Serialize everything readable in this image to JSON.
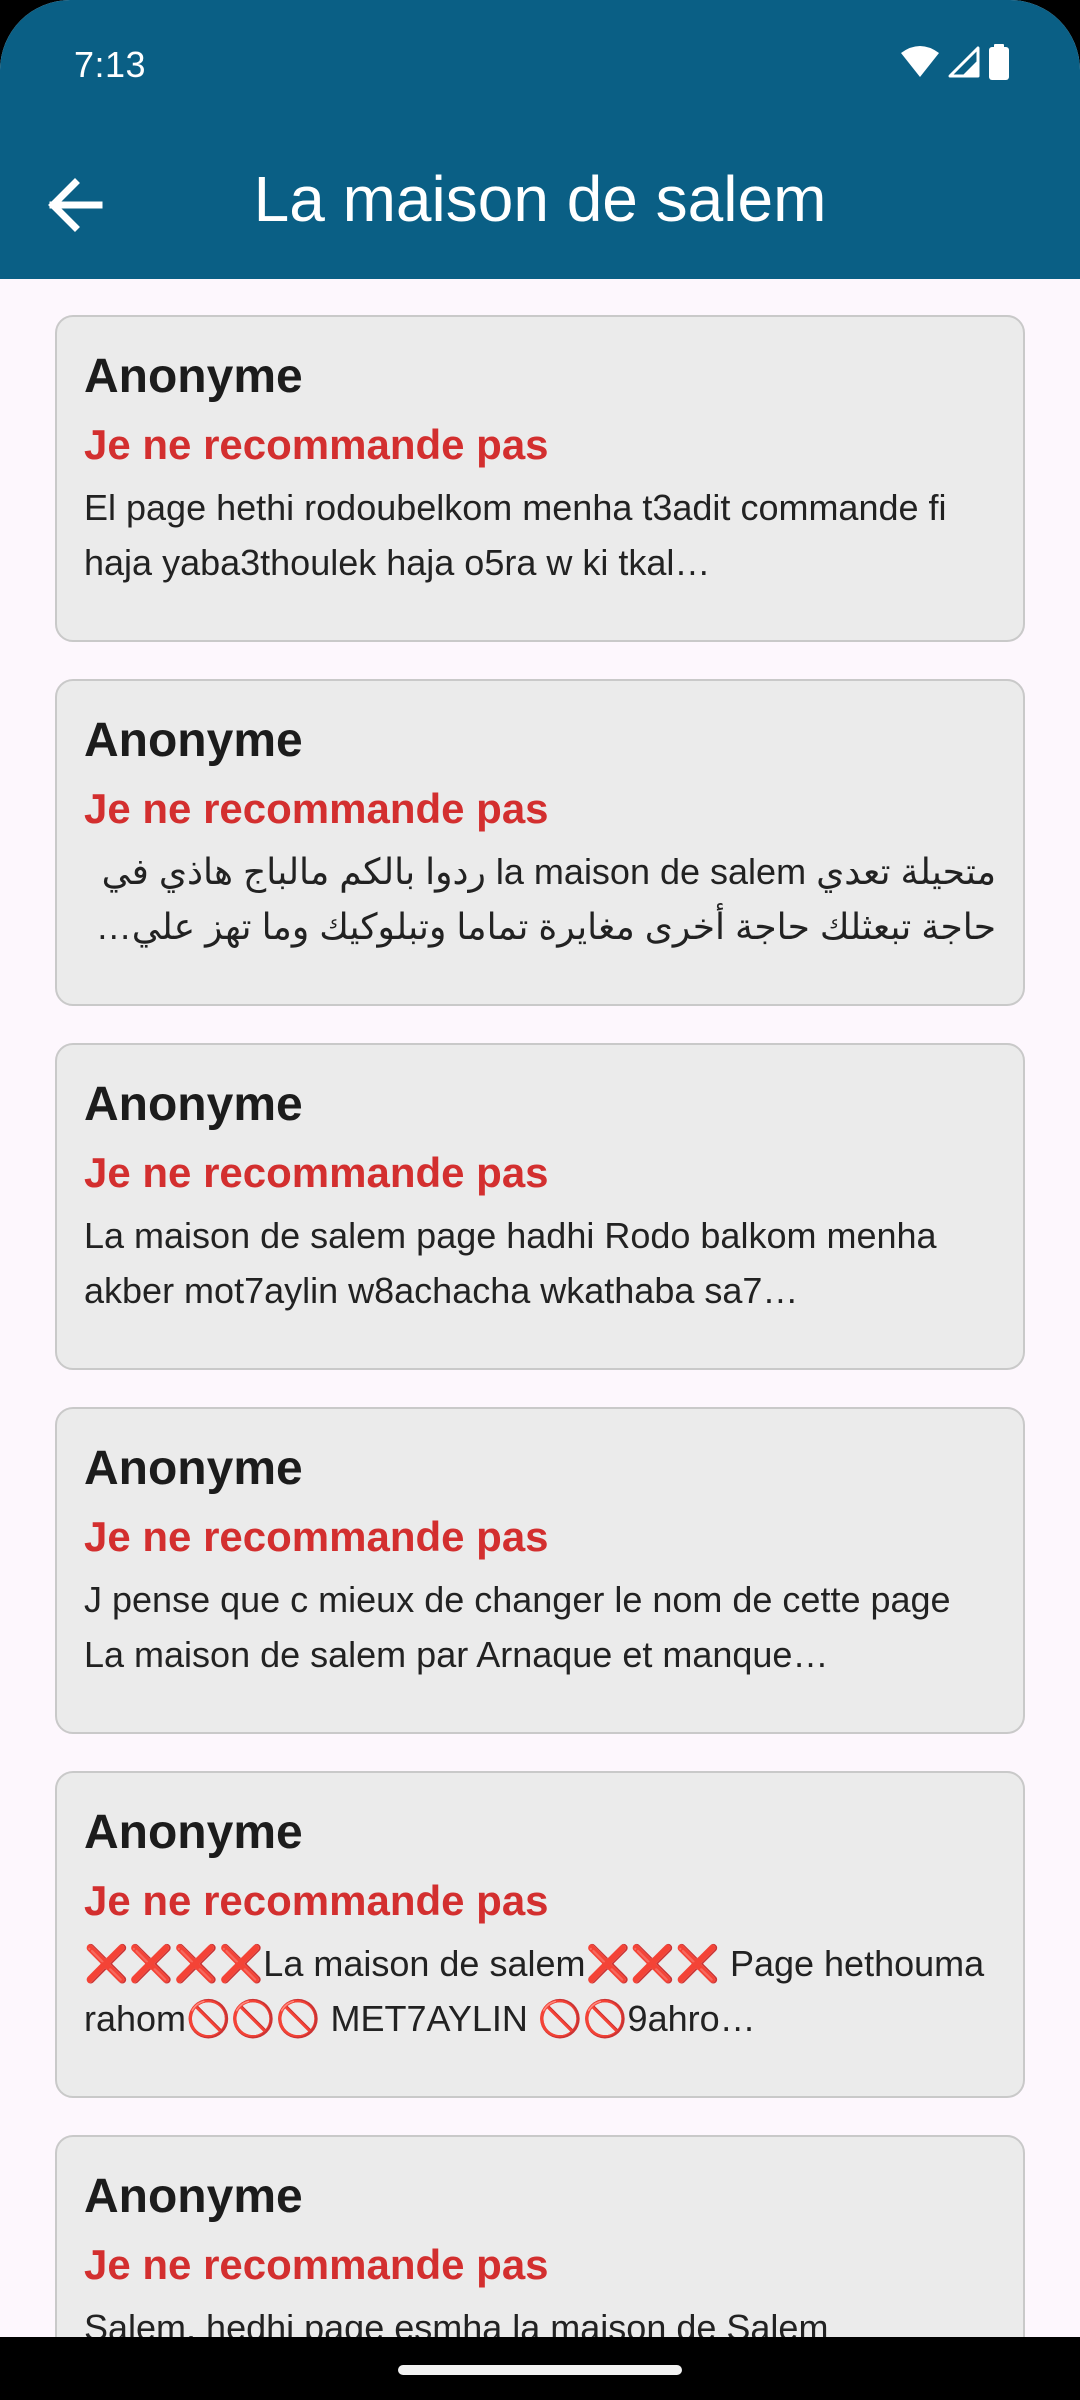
{
  "status_bar": {
    "time": "7:13",
    "icons": [
      "wifi-icon",
      "cellular-signal-icon",
      "battery-icon"
    ]
  },
  "app_bar": {
    "title": "La maison de salem",
    "back_icon": "arrow-left-icon",
    "background_color": "#0a5f85"
  },
  "colors": {
    "rating_negative": "#d32f2f",
    "card_background": "#ebebeb",
    "page_background": "#fdf7fd"
  },
  "reviews": [
    {
      "author": "Anonyme",
      "rating_label": "Je ne recommande pas",
      "text": "El page hethi rodoubelkom menha t3adit commande fi haja yaba3thoulek haja o5ra w ki tkal…"
    },
    {
      "author": "Anonyme",
      "rating_label": "Je ne recommande pas",
      "text": "متحيلة تعدي  la maison de salem  ردوا بالكم مالباج هاذي في حاجة تبعثلك حاجة أخرى مغايرة تماما وتبلوكيك وما تهز علي…"
    },
    {
      "author": "Anonyme",
      "rating_label": "Je ne recommande pas",
      "text": "La maison de salem page hadhi Rodo balkom menha akber mot7aylin w8achacha wkathaba sa7…"
    },
    {
      "author": "Anonyme",
      "rating_label": "Je ne recommande pas",
      "text": "J pense que c mieux de changer le nom de cette page La maison de salem  par Arnaque et manque…"
    },
    {
      "author": "Anonyme",
      "rating_label": "Je ne recommande pas",
      "text": "❌❌❌❌La maison de salem❌❌❌ Page hethouma rahom🚫🚫🚫 MET7AYLIN 🚫🚫9ahro…"
    },
    {
      "author": "Anonyme",
      "rating_label": "Je ne recommande pas",
      "text": "Salem, hedhi page esmha la maison de Salem"
    }
  ]
}
